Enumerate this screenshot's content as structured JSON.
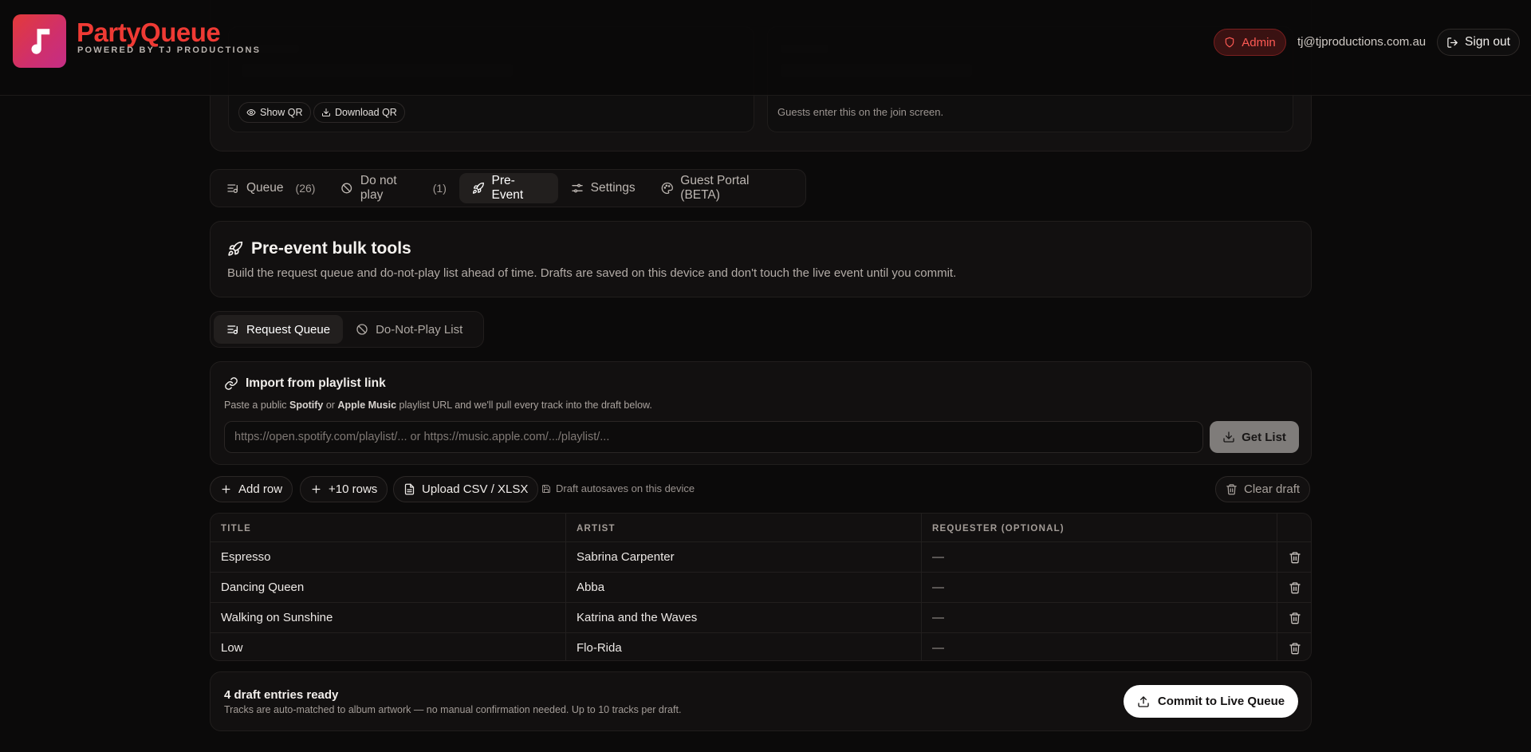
{
  "header": {
    "brand_name": "PartyQueue",
    "brand_subtitle": "POWERED BY TJ PRODUCTIONS",
    "admin_label": "Admin",
    "user_email": "tj@tjproductions.com.au",
    "signout_label": "Sign out"
  },
  "top_card": {
    "show_qr_label": "Show QR",
    "download_qr_label": "Download QR",
    "code_hint": "Guests enter this on the join screen."
  },
  "main_tabs": [
    {
      "label": "Queue",
      "count": "(26)",
      "icon": "queue-icon"
    },
    {
      "label": "Do not play",
      "count": "(1)",
      "icon": "ban-icon"
    },
    {
      "label": "Pre-Event",
      "icon": "rocket-icon",
      "active": true
    },
    {
      "label": "Settings",
      "icon": "sliders-icon"
    },
    {
      "label": "Guest Portal (BETA)",
      "icon": "palette-icon"
    }
  ],
  "pre_event": {
    "title": "Pre-event bulk tools",
    "description": "Build the request queue and do-not-play list ahead of time. Drafts are saved on this device and don't touch the live event until you commit."
  },
  "sub_tabs": [
    {
      "label": "Request Queue",
      "icon": "queue-icon",
      "active": true
    },
    {
      "label": "Do-Not-Play List",
      "icon": "ban-icon"
    }
  ],
  "import": {
    "title": "Import from playlist link",
    "desc_prefix": "Paste a public ",
    "desc_spotify": "Spotify",
    "desc_or": " or ",
    "desc_apple": "Apple Music",
    "desc_suffix": " playlist URL and we'll pull every track into the draft below.",
    "url_value": "",
    "url_placeholder": "https://open.spotify.com/playlist/... or https://music.apple.com/.../playlist/...",
    "get_list_label": "Get List"
  },
  "toolbar": {
    "add_row_label": "Add row",
    "add_ten_label": "+10 rows",
    "upload_label": "Upload CSV / XLSX",
    "autosave_note": "Draft autosaves on this device",
    "clear_label": "Clear draft"
  },
  "table": {
    "headers": [
      "TITLE",
      "ARTIST",
      "REQUESTER (OPTIONAL)"
    ],
    "rows": [
      {
        "title": "Espresso",
        "artist": "Sabrina Carpenter",
        "requester": "—"
      },
      {
        "title": "Dancing Queen",
        "artist": "Abba",
        "requester": "—"
      },
      {
        "title": "Walking on Sunshine",
        "artist": "Katrina and the Waves",
        "requester": "—"
      },
      {
        "title": "Low",
        "artist": "Flo-Rida",
        "requester": "—"
      }
    ]
  },
  "commit": {
    "title": "4 draft entries ready",
    "description": "Tracks are auto-matched to album artwork — no manual confirmation needed. Up to 10 tracks per draft.",
    "button_label": "Commit to Live Queue"
  },
  "colors": {
    "brand": "#ef3a34",
    "admin": "#ff5a54",
    "background": "#0b0a0a"
  }
}
